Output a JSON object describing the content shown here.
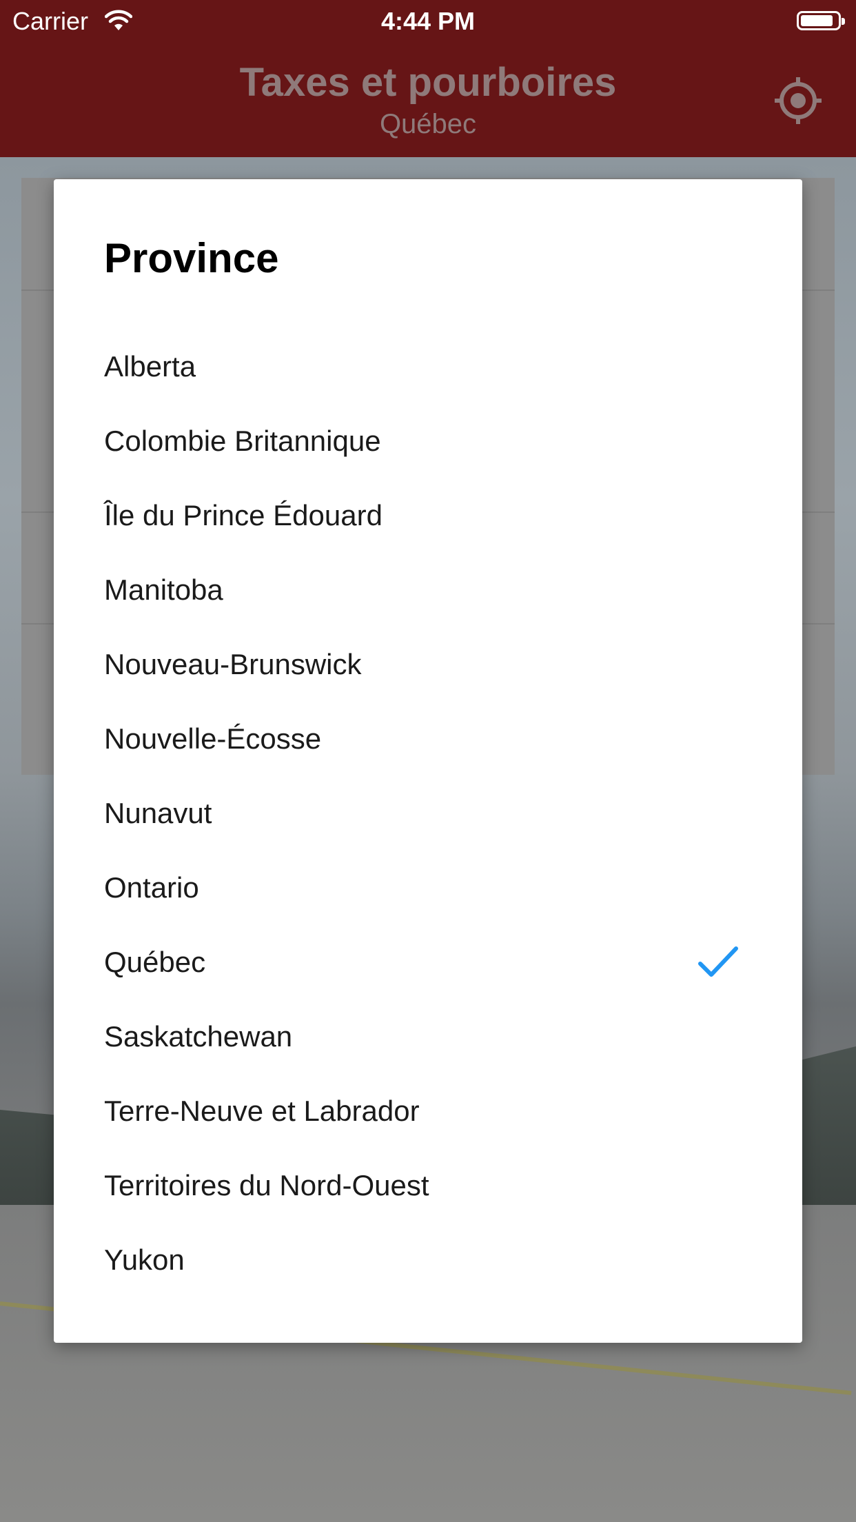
{
  "status_bar": {
    "carrier": "Carrier",
    "time": "4:44 PM"
  },
  "header": {
    "title": "Taxes et pourboires",
    "subtitle": "Québec",
    "locate_icon": "crosshair-location-icon"
  },
  "dialog": {
    "title": "Province",
    "selected": "Québec",
    "accent_color": "#2196F3",
    "options": [
      {
        "label": "Alberta"
      },
      {
        "label": "Colombie Britannique"
      },
      {
        "label": "Île du Prince Édouard"
      },
      {
        "label": "Manitoba"
      },
      {
        "label": "Nouveau-Brunswick"
      },
      {
        "label": "Nouvelle-Écosse"
      },
      {
        "label": "Nunavut"
      },
      {
        "label": "Ontario"
      },
      {
        "label": "Québec"
      },
      {
        "label": "Saskatchewan"
      },
      {
        "label": "Terre-Neuve et Labrador"
      },
      {
        "label": "Territoires du Nord-Ouest"
      },
      {
        "label": "Yukon"
      }
    ]
  },
  "colors": {
    "nav_bar": "#661516",
    "dialog_bg": "#FFFFFF",
    "check": "#2196F3"
  }
}
